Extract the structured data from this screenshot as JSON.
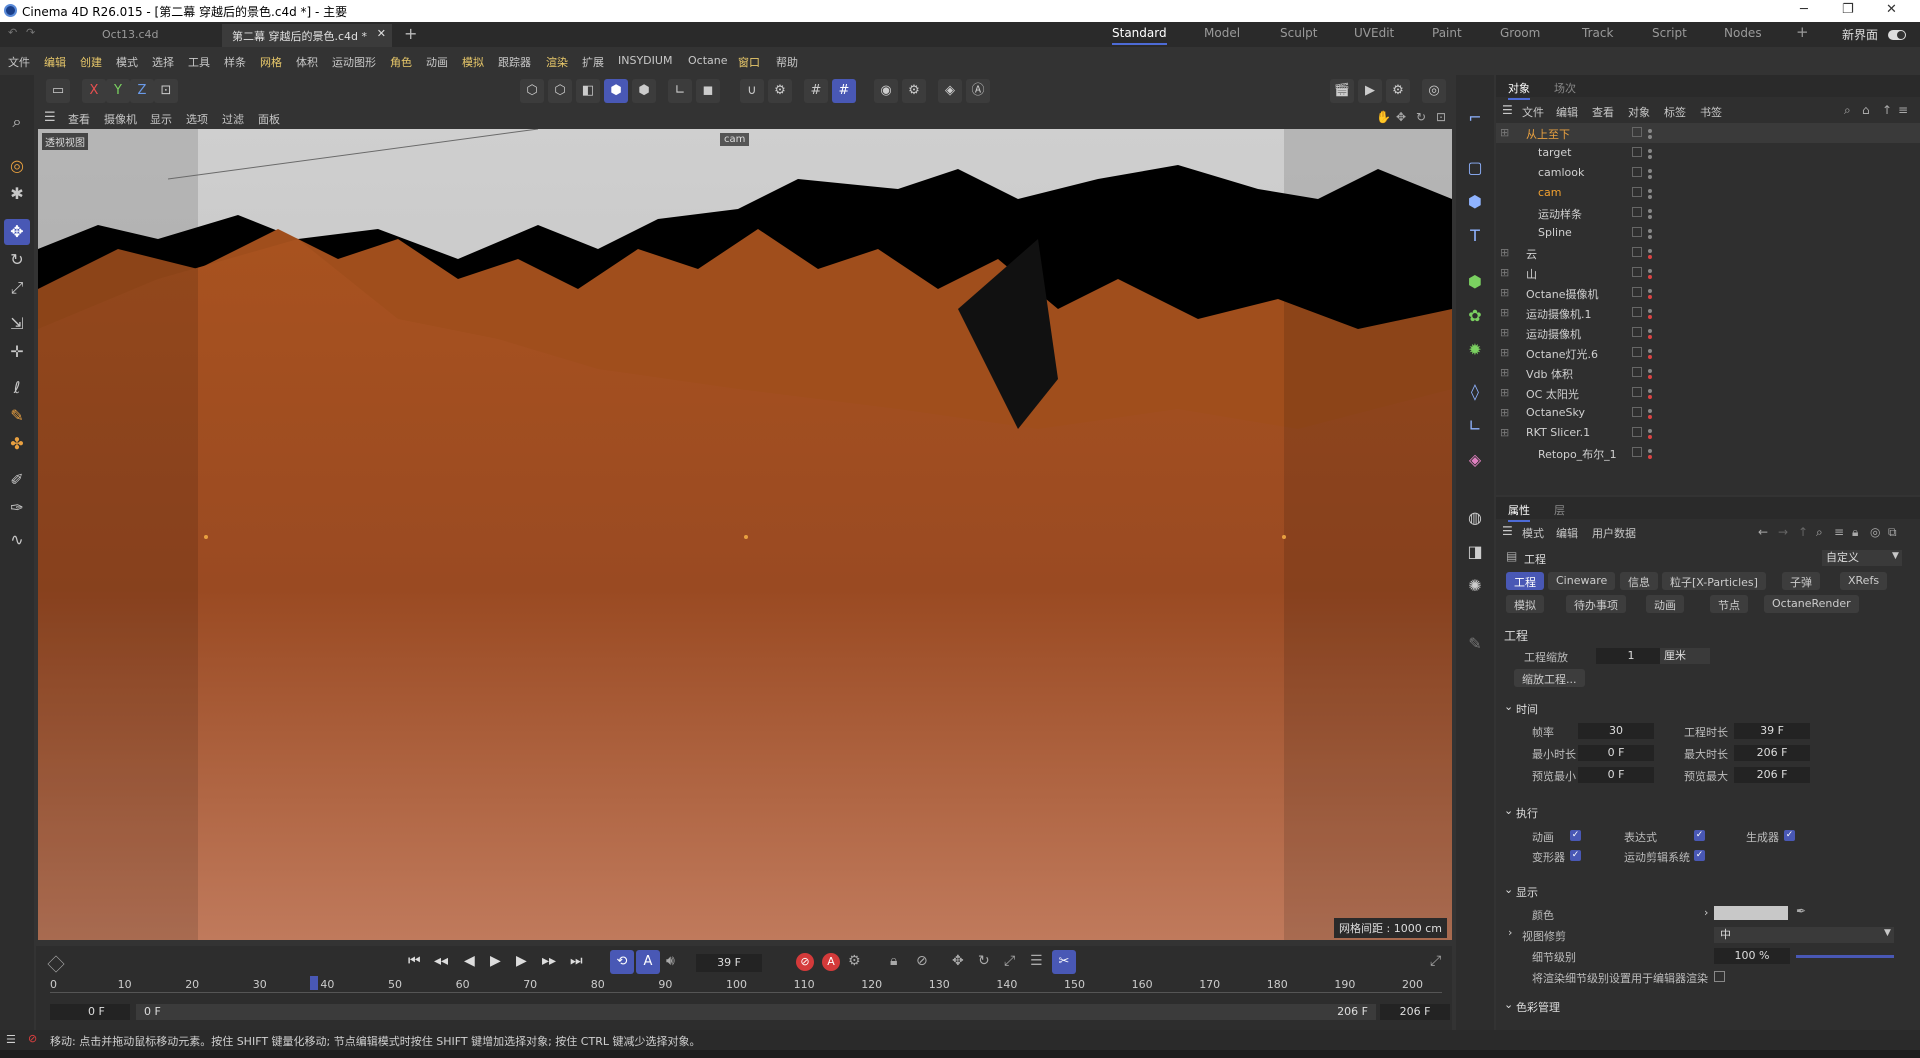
{
  "title": "Cinema 4D R26.015 - [第二幕 穿越后的景色.c4d *] - 主要",
  "file_tabs": [
    "Oct13.c4d",
    "第二幕 穿越后的景色.c4d *"
  ],
  "layouts": [
    "Standard",
    "Model",
    "Sculpt",
    "UVEdit",
    "Paint",
    "Groom",
    "Track",
    "Script",
    "Nodes"
  ],
  "new_ui_label": "新界面",
  "menu": [
    "文件",
    "编辑",
    "创建",
    "模式",
    "选择",
    "工具",
    "样条",
    "网格",
    "体积",
    "运动图形",
    "角色",
    "动画",
    "模拟",
    "跟踪器",
    "渲染",
    "扩展",
    "INSYDIUM",
    "Octane",
    "窗口",
    "帮助"
  ],
  "axes": [
    "X",
    "Y",
    "Z"
  ],
  "viewport_menu": [
    "查看",
    "摄像机",
    "显示",
    "选项",
    "过滤",
    "面板"
  ],
  "viewport_label": "透视视图",
  "camera_tag": "cam",
  "grid_spacing": "网格间距 : 1000 cm",
  "timeline": {
    "current_frame": "39 F",
    "ticks": [
      "0",
      "10",
      "20",
      "30",
      "40",
      "50",
      "60",
      "70",
      "80",
      "90",
      "100",
      "110",
      "120",
      "130",
      "140",
      "150",
      "160",
      "170",
      "180",
      "190",
      "200"
    ],
    "playhead": "39",
    "start": "0 F",
    "range_start": "0 F",
    "range_end": "206 F",
    "end": "206 F"
  },
  "status": "移动: 点击并拖动鼠标移动元素。按住 SHIFT 键量化移动; 节点编辑模式时按住 SHIFT 键增加选择对象; 按住 CTRL 键减少选择对象。",
  "object_manager": {
    "tabs": [
      "对象",
      "场次"
    ],
    "menu": [
      "文件",
      "编辑",
      "查看",
      "对象",
      "标签",
      "书签"
    ],
    "objects": [
      {
        "name": "从上至下",
        "level": 0,
        "color": "#e8a040"
      },
      {
        "name": "target",
        "level": 1,
        "color": "#d0d0d0"
      },
      {
        "name": "camlook",
        "level": 1,
        "color": "#d0d0d0"
      },
      {
        "name": "cam",
        "level": 1,
        "color": "#f0a030"
      },
      {
        "name": "运动样条",
        "level": 1,
        "color": "#d0d0d0"
      },
      {
        "name": "Spline",
        "level": 1,
        "color": "#d0d0d0"
      },
      {
        "name": "云",
        "level": 0,
        "color": "#d0d0d0"
      },
      {
        "name": "山",
        "level": 0,
        "color": "#d0d0d0"
      },
      {
        "name": "Octane摄像机",
        "level": 0,
        "color": "#d0d0d0"
      },
      {
        "name": "运动摄像机.1",
        "level": 0,
        "color": "#d0d0d0"
      },
      {
        "name": "运动摄像机",
        "level": 0,
        "color": "#d0d0d0"
      },
      {
        "name": "Octane灯光.6",
        "level": 0,
        "color": "#d0d0d0"
      },
      {
        "name": "Vdb 体积",
        "level": 0,
        "color": "#d0d0d0"
      },
      {
        "name": "OC 太阳光",
        "level": 0,
        "color": "#d0d0d0"
      },
      {
        "name": "OctaneSky",
        "level": 0,
        "color": "#d0d0d0"
      },
      {
        "name": "RKT Slicer.1",
        "level": 0,
        "color": "#d0d0d0"
      },
      {
        "name": "Retopo_布尔_1",
        "level": 1,
        "color": "#d0d0d0"
      }
    ]
  },
  "attributes": {
    "tabs": [
      "属性",
      "层"
    ],
    "menu": [
      "模式",
      "编辑",
      "用户数据"
    ],
    "object_type": "工程",
    "preset": "自定义",
    "chips_row1": [
      "工程",
      "Cineware",
      "信息",
      "粒子[X-Particles]",
      "子弹",
      "XRefs"
    ],
    "chips_row2": [
      "模拟",
      "待办事项",
      "动画",
      "节点",
      "OctaneRender"
    ],
    "section_title": "工程",
    "scale_label": "工程缩放",
    "scale_value": "1",
    "scale_unit": "厘米",
    "scale_button": "缩放工程...",
    "time_section": "时间",
    "fps_label": "帧率",
    "fps": "30",
    "duration_label": "工程时长",
    "duration": "39 F",
    "min_label": "最小时长",
    "min": "0 F",
    "max_label": "最大时长",
    "max": "206 F",
    "pmin_label": "预览最小",
    "pmin": "0 F",
    "pmax_label": "预览最大",
    "pmax": "206 F",
    "exec_section": "执行",
    "anim_label": "动画",
    "expr_label": "表达式",
    "gen_label": "生成器",
    "deform_label": "变形器",
    "mograph_label": "运动剪辑系统",
    "display_section": "显示",
    "color_label": "颜色",
    "clip_label": "视图修剪",
    "clip_value": "中",
    "lod_label": "细节级别",
    "lod_value": "100 %",
    "lod_render_label": "将渲染细节级别设置用于编辑器渲染",
    "color_mgmt_section": "色彩管理"
  }
}
